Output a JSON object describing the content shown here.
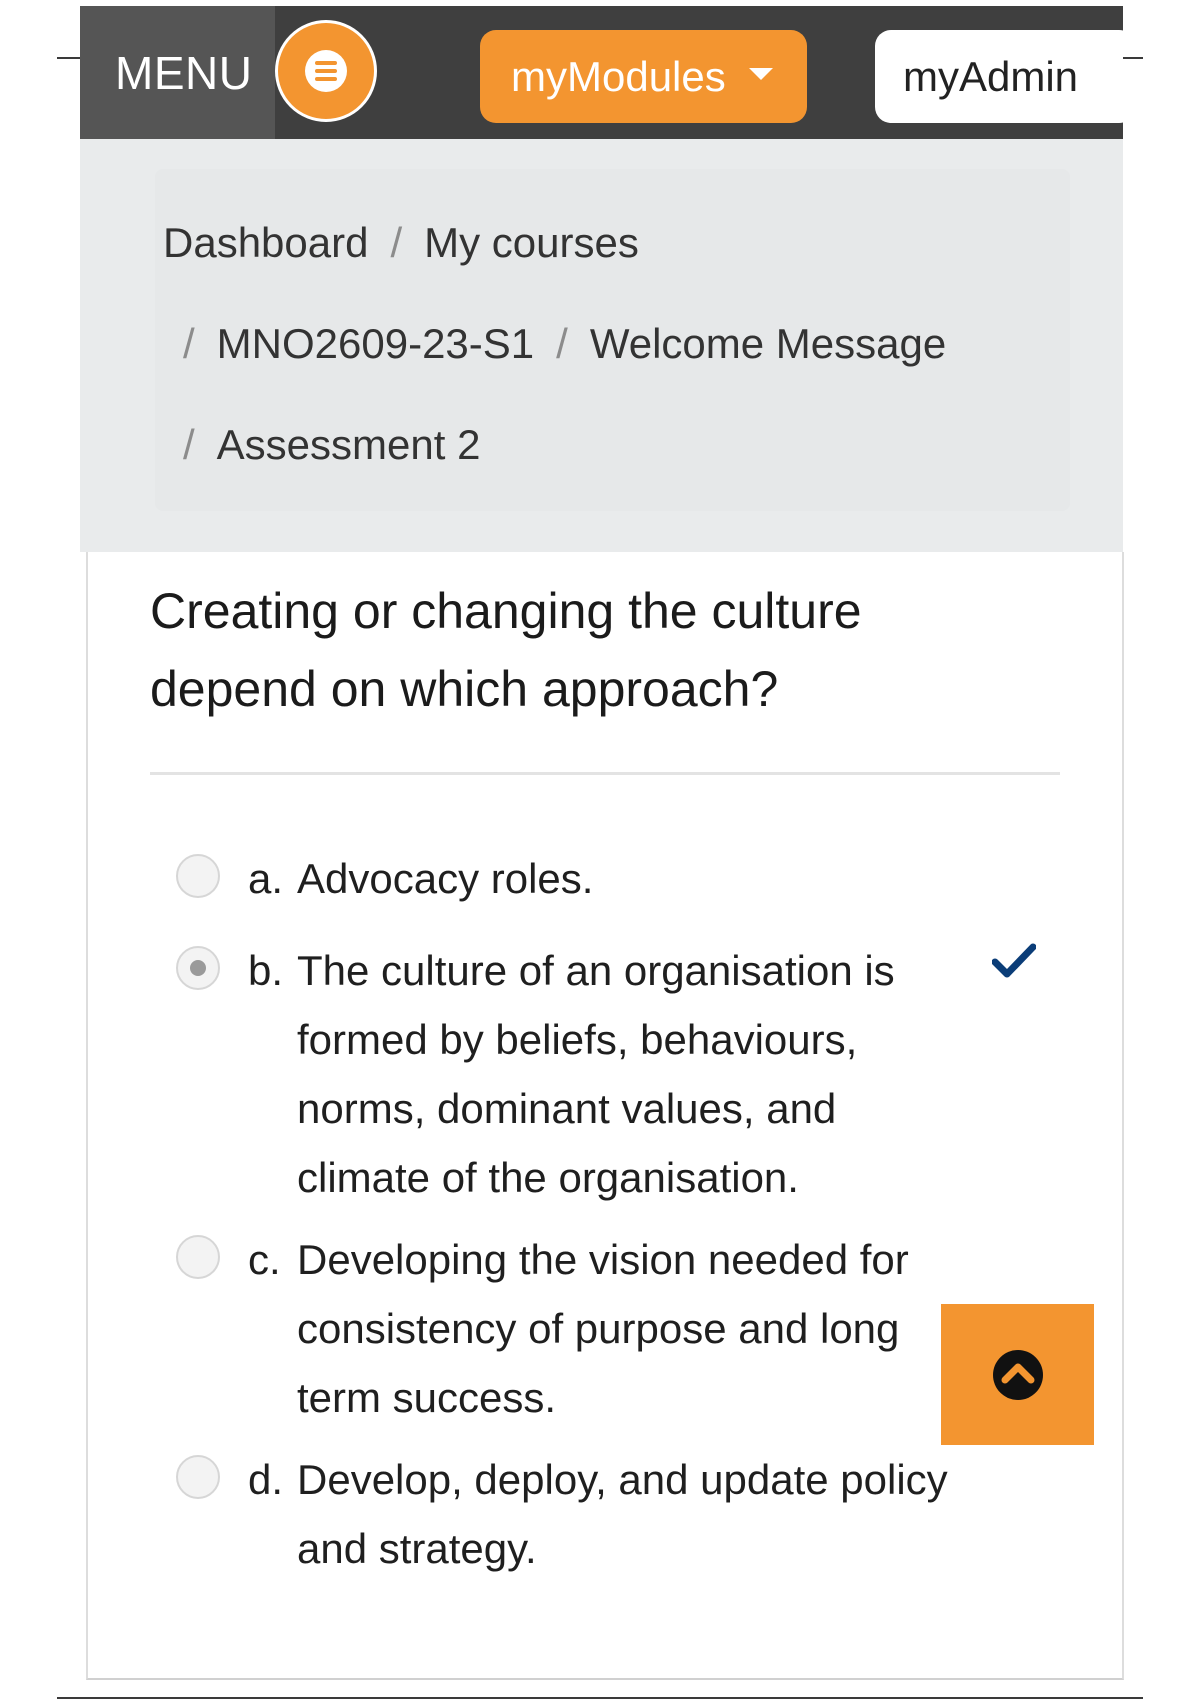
{
  "header": {
    "menu_label": "MENU",
    "hamburger_icon": "hamburger-icon",
    "modules_label": "myModules",
    "admin_label": "myAdmin",
    "accent_color": "#f39530"
  },
  "breadcrumb": {
    "items": [
      "Dashboard",
      "My courses",
      "MNO2609-23-S1",
      "Welcome Message",
      "Assessment 2"
    ],
    "separator": "/"
  },
  "question": {
    "text": "Creating or changing the culture depend on which approach?",
    "options": [
      {
        "letter": "a.",
        "text": "Advocacy roles.",
        "selected": false
      },
      {
        "letter": "b.",
        "text": "The culture of an organisation is formed by beliefs, behaviours, norms, dominant values, and climate of the organisation.",
        "selected": true,
        "correct": true
      },
      {
        "letter": "c.",
        "text": "Developing the vision needed for consistency of purpose and long term success.",
        "selected": false
      },
      {
        "letter": "d.",
        "text": "Develop, deploy, and update policy and strategy.",
        "selected": false
      }
    ]
  },
  "icons": {
    "correct": "checkmark-icon",
    "scroll_top": "chevron-up-circle-icon"
  }
}
